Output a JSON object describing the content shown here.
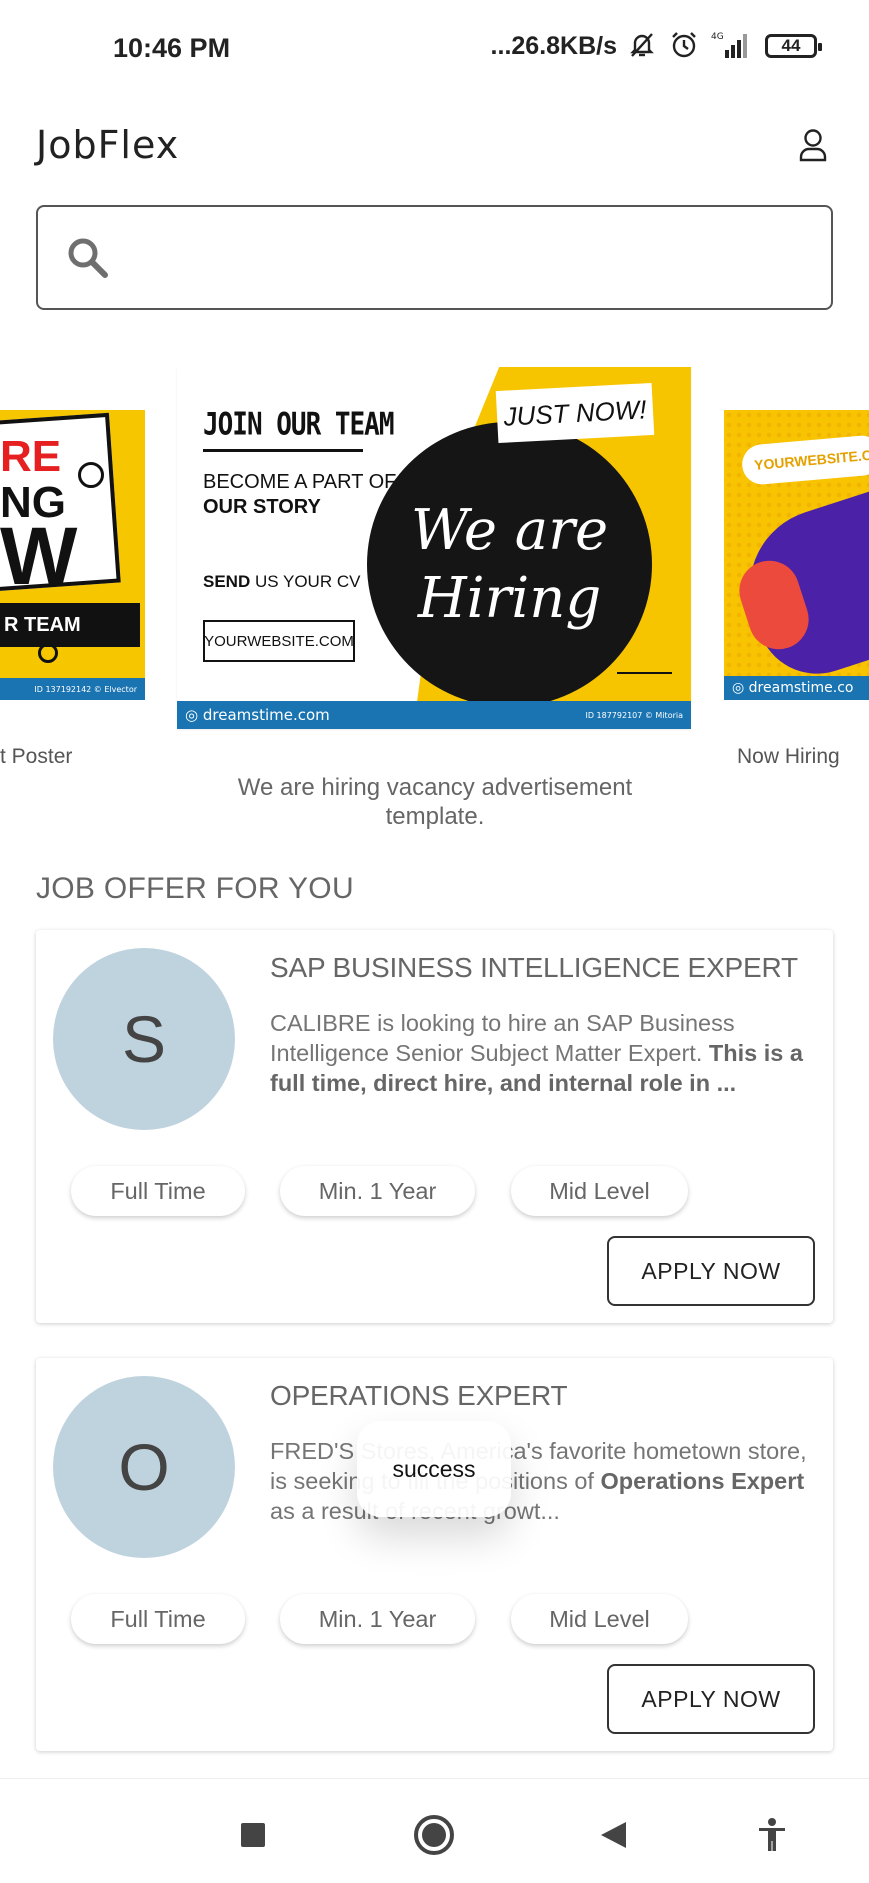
{
  "status_bar": {
    "time": "10:46 PM",
    "net_speed": "...26.8KB/s",
    "network": "4G",
    "battery": "44"
  },
  "header": {
    "app_title": "JobFlex"
  },
  "search": {
    "placeholder": ""
  },
  "carousel": {
    "left_caption": "t Poster",
    "right_caption": "Now Hiring",
    "center_caption": "We are hiring vacancy advertisement template.",
    "center_banner": {
      "join": "JOIN OUR TEAM",
      "become": "BECOME A PART OF",
      "story": "OUR STORY",
      "send": "SEND",
      "send_rest": " US YOUR CV",
      "website": "YOURWEBSITE.COM",
      "just_now": "JUST NOW!",
      "we_are": "We are",
      "hiring": "Hiring",
      "footer_brand": "dreamstime.com",
      "footer_id": "ID 187792107 © Mitoria"
    },
    "left_banner": {
      "re": "RE",
      "ng": "NG",
      "w": "W",
      "team": "R TEAM",
      "footer_id": "ID 137192142 © Elvector"
    },
    "right_banner": {
      "site": "YOURWEBSITE.CO",
      "footer_brand": "dreamstime.co"
    }
  },
  "section": {
    "title": "JOB OFFER FOR YOU"
  },
  "jobs": [
    {
      "initial": "S",
      "title": "SAP BUSINESS INTELLIGENCE EXPERT",
      "desc_plain": "CALIBRE is looking to hire an SAP Business Intelligence Senior Subject Matter Expert. ",
      "desc_bold": "This is a full time, direct hire, and internal role in ...",
      "tags": [
        "Full Time",
        "Min. 1 Year",
        "Mid Level"
      ],
      "apply_label": "APPLY NOW"
    },
    {
      "initial": "O",
      "title": "OPERATIONS EXPERT",
      "desc_plain": "FRED'S Stores, America's favorite hometown store, is seeking to fill the positions of ",
      "desc_bold": "Operations Expert",
      "desc_after": " as a result of recent growt...",
      "tags": [
        "Full Time",
        "Min. 1 Year",
        "Mid Level"
      ],
      "apply_label": "APPLY NOW"
    }
  ],
  "toast": {
    "message": "success"
  },
  "icons": {
    "search": "search-icon",
    "profile": "user-icon",
    "nav_recent": "square-icon",
    "nav_home": "circle-icon",
    "nav_back": "triangle-back-icon",
    "nav_accessibility": "accessibility-icon"
  },
  "colors": {
    "avatar_bg": "#bfd3de",
    "banner_yellow": "#f7c500",
    "dreamstime_blue": "#1a74b1"
  }
}
